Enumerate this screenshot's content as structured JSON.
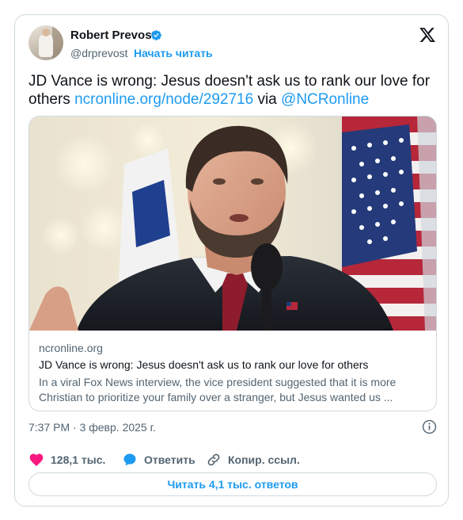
{
  "author": {
    "name": "Robert Prevost",
    "handle": "@drprevost",
    "follow_label": "Начать читать",
    "avatar_icon": "avatar-photo",
    "verified_icon": "verified-badge-icon"
  },
  "platform_icon": "x-logo-icon",
  "tweet": {
    "text_main": "JD Vance is wrong: Jesus doesn't ask us to rank our love for others ",
    "link_url": "ncronline.org/node/292716",
    "via_word": " via ",
    "mention": "@NCRonline"
  },
  "link_card": {
    "domain": "ncronline.org",
    "title": "JD Vance is wrong: Jesus doesn't ask us to rank our love for others",
    "description": "In a viral Fox News interview, the vice president suggested that it is more Christian to prioritize your family over a stranger, but Jesus wanted us ...",
    "image": "photo of a man in a suit with flags behind"
  },
  "timestamp": "7:37 PM · 3 февр. 2025 г.",
  "actions": {
    "likes": "128,1 тыс.",
    "reply_label": "Ответить",
    "copy_link_label": "Копир. ссыл."
  },
  "read_replies_label": "Читать 4,1 тыс. ответов",
  "colors": {
    "accent": "#1d9bf0",
    "like": "#f91880",
    "text": "#0f1419",
    "secondary": "#536471",
    "border": "#cfd9de"
  }
}
